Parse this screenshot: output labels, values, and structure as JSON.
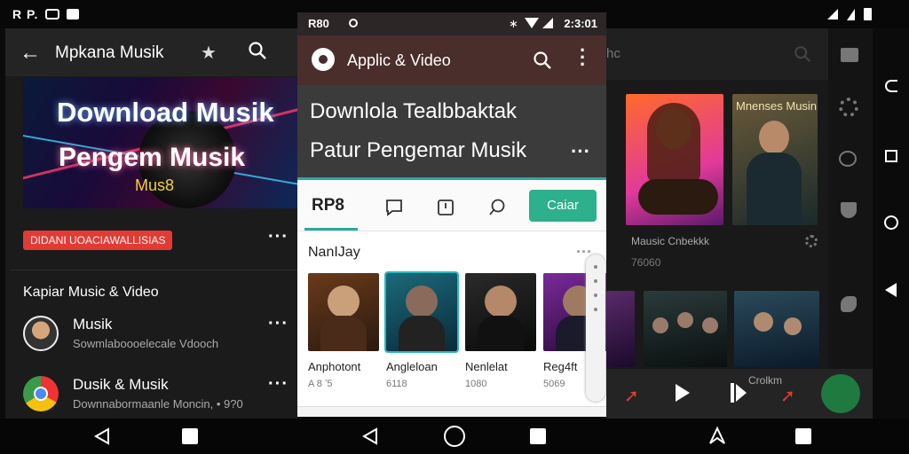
{
  "status_bar": {
    "left_text": "R P.",
    "mid_left": "R80",
    "mid_time": "2:3:01"
  },
  "left_panel": {
    "title": "Mpkana Musik",
    "banner": {
      "line1": "Download Musik",
      "line2": "Pengem Musik",
      "line3": "Mus8"
    },
    "red_pill": "DIDANI UOACIAWALLISIAS",
    "section_title": "Kapiar Music & Video",
    "rows": [
      {
        "title": "Musik",
        "subtitle": "Sowmlaboooelecale Vdooch"
      },
      {
        "title": "Dusik & Musik",
        "subtitle": "Downnabormaanle Moncin,",
        "extra": "• 9?0"
      }
    ]
  },
  "middle_panel": {
    "header_title": "Applic & Video",
    "headline1": "Downlola Tealbbaktak",
    "headline2": "Patur Pengemar Musik",
    "tab_active": "RP8",
    "cari_button": "Caiar",
    "section_title": "NanIJay",
    "cards": [
      {
        "title": "Anphotont",
        "meta": "A 8 ʼ5"
      },
      {
        "title": "Angleloan",
        "meta": "6118"
      },
      {
        "title": "Nenlelat",
        "meta": "1080"
      },
      {
        "title": "Reg4ft",
        "meta": "5069"
      }
    ]
  },
  "right_panel": {
    "header_title": "hc",
    "poster_title": "Mnenses Musin",
    "caption1": "Mausic Cnbekkk",
    "caption2": "7‍6060",
    "caption3": "Crolkm"
  },
  "colors": {
    "accent_teal": "#2aa8a0",
    "cari_green": "#2db08c",
    "pill_red": "#e23a34",
    "header_brown": "#4a2e2b"
  }
}
